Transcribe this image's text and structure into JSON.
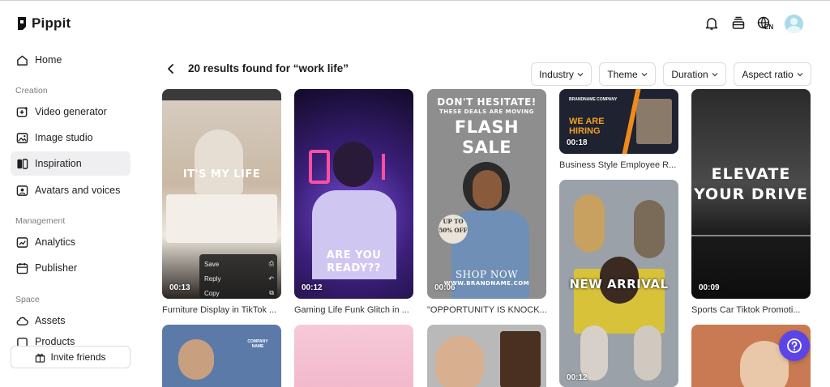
{
  "app": {
    "name": "Pippit"
  },
  "sidebar": {
    "items": [
      {
        "label": "Home"
      },
      {
        "label": "Video generator"
      },
      {
        "label": "Image studio"
      },
      {
        "label": "Inspiration"
      },
      {
        "label": "Avatars and voices"
      },
      {
        "label": "Analytics"
      },
      {
        "label": "Publisher"
      },
      {
        "label": "Assets"
      },
      {
        "label": "Products"
      }
    ],
    "sections": [
      "Creation",
      "Management",
      "Space"
    ],
    "active_item": "Inspiration",
    "invite_label": "Invite friends"
  },
  "header": {
    "icons": [
      "bell-icon",
      "inbox-icon",
      "globe-language-icon",
      "avatar"
    ],
    "language": "EN"
  },
  "results": {
    "title": "20 results found for “work life”",
    "filters": [
      "Industry",
      "Theme",
      "Duration",
      "Aspect ratio"
    ]
  },
  "cards": [
    {
      "caption": "Furniture Display in TikTok ...",
      "duration": "00:13",
      "overlay": "IT'S MY LIFE",
      "menu": [
        "Save",
        "Reply",
        "Copy"
      ]
    },
    {
      "caption": "Gaming Life Funk Glitch in ...",
      "duration": "00:12",
      "overlay": "ARE YOU READY??"
    },
    {
      "caption": "\"OPPORTUNITY IS KNOCK...",
      "duration": "00:06",
      "overlay_top": "DON'T HESITATE!",
      "overlay_sub": "THESE DEALS ARE MOVING",
      "overlay_main": "FLASH SALE",
      "badge": "UP TO 50% OFF",
      "overlay_bottom": "SHOP NOW",
      "url": "WWW.BRANDNAME.COM"
    },
    {
      "caption": "Business Style Employee R...",
      "duration": "00:18",
      "overlay": "WE ARE HIRING",
      "brand": "BRANDNAME COMPANY"
    },
    {
      "caption": "",
      "duration": "00:12",
      "overlay": "NEW ARRIVAL"
    },
    {
      "caption": "Sports Car Tiktok Promoti...",
      "duration": "00:09",
      "overlay": "ELEVATE YOUR DRIVE"
    },
    {
      "caption": "",
      "overlay": "COMPANY NAME"
    },
    {
      "caption": ""
    },
    {
      "caption": ""
    },
    {
      "caption": ""
    }
  ]
}
